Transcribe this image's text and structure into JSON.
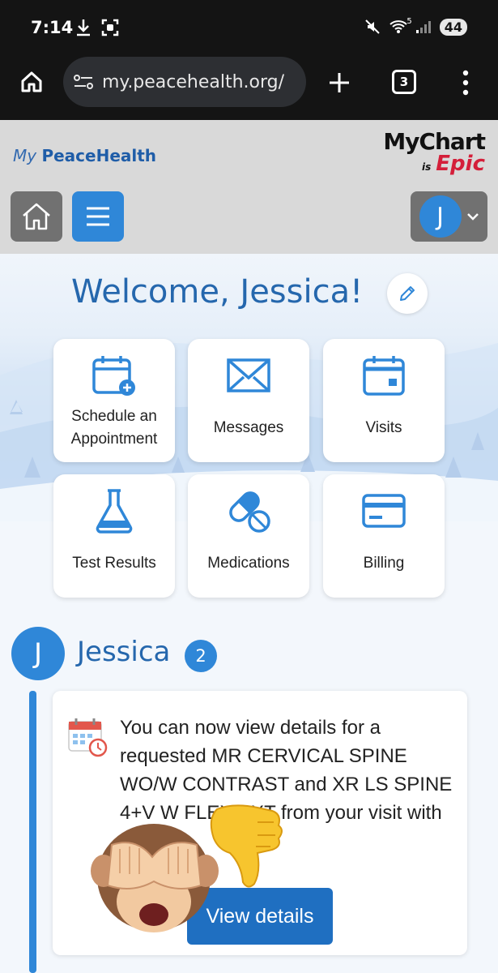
{
  "status_bar": {
    "time": "7:14",
    "battery": "44",
    "wifi_label": "5"
  },
  "browser": {
    "url": "my.peacehealth.org/",
    "tab_count": "3"
  },
  "header": {
    "brand_prefix": "My",
    "brand_name": "PeaceHealth",
    "mychart": "MyChart",
    "is": "is",
    "epic": "Epic",
    "account_initial": "J"
  },
  "hero": {
    "welcome": "Welcome, Jessica!",
    "tiles": [
      {
        "label": "Schedule an Appointment",
        "icon": "calendar-plus-icon"
      },
      {
        "label": "Messages",
        "icon": "envelope-icon"
      },
      {
        "label": "Visits",
        "icon": "calendar-icon"
      },
      {
        "label": "Test Results",
        "icon": "flask-icon"
      },
      {
        "label": "Medications",
        "icon": "pill-icon"
      },
      {
        "label": "Billing",
        "icon": "credit-card-icon"
      }
    ]
  },
  "feed": {
    "initial": "J",
    "name": "Jessica",
    "badge": "2",
    "card_text": "You can now view details for a requested MR CERVICAL SPINE WO/W CONTRAST and XR LS SPINE 4+V W FLEX/EXT from your visit with",
    "button": "View details"
  },
  "colors": {
    "accent": "#2f87d8",
    "title": "#2567ad",
    "epic": "#d41f3a"
  }
}
